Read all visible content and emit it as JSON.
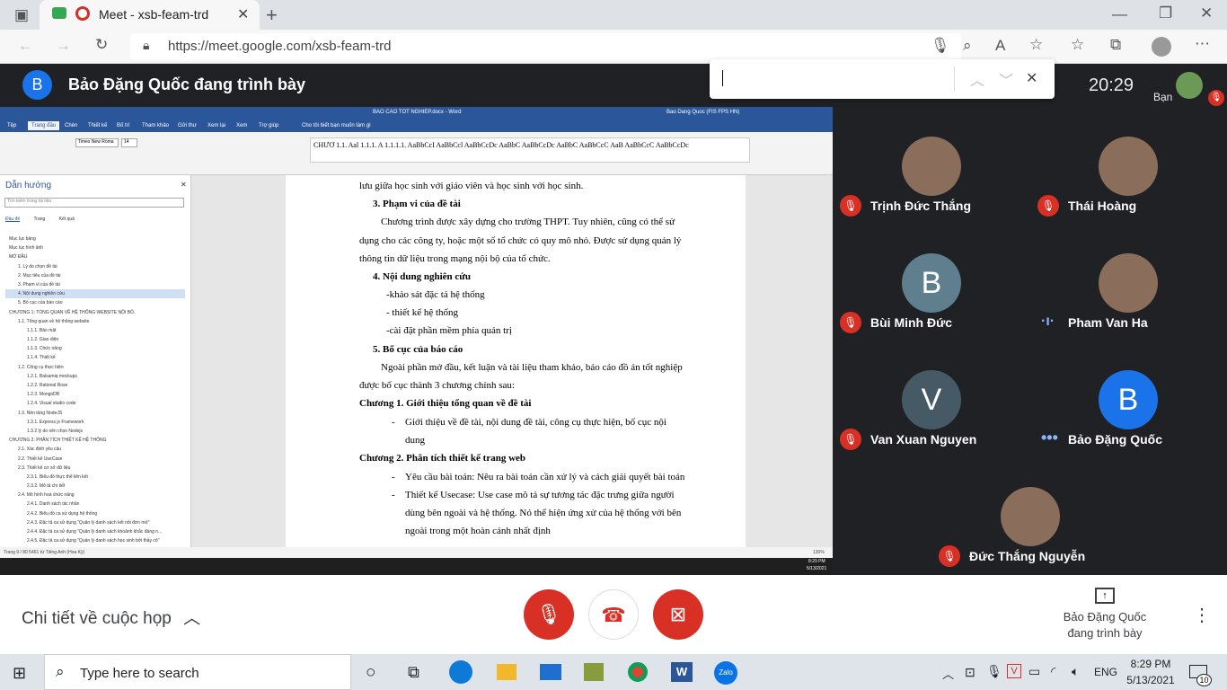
{
  "browser": {
    "tab_title": "Meet - xsb-feam-trd",
    "url": "https://meet.google.com/xsb-feam-trd"
  },
  "meet": {
    "presenter_banner": "Bảo Đặng Quốc đang trình bày",
    "avatar_letter": "B",
    "clock": "20:29",
    "self_label": "Bạn",
    "details_label": "Chi tiết về cuộc họp",
    "presenter_label": "Bảo Đặng Quốc đang trình bày"
  },
  "participants": [
    {
      "name": "Trịnh Đức Thắng",
      "avatar": "photo",
      "status": "muted"
    },
    {
      "name": "Thái Hoàng",
      "avatar": "photo",
      "status": "muted"
    },
    {
      "name": "Bùi Minh Đức",
      "avatar": "B",
      "status": "muted"
    },
    {
      "name": "Pham Van Ha",
      "avatar": "photo",
      "status": "speaking"
    },
    {
      "name": "Van Xuan Nguyen",
      "avatar": "V",
      "status": "muted"
    },
    {
      "name": "Bảo Đặng Quốc",
      "avatar": "B",
      "status": "active"
    },
    {
      "name": "Đức Thắng Nguyễn",
      "avatar": "photo",
      "status": "muted"
    }
  ],
  "word": {
    "window_title": "BAO CAO TOT NGHIEP.docx - Word",
    "user": "Bao Dang Quoc (FIS FPS HN)",
    "tabs": [
      "Tệp",
      "Trang đầu",
      "Chèn",
      "Thiết kế",
      "Bố trí",
      "Tham khảo",
      "Gửi thư",
      "Xem lại",
      "Xem",
      "Trợ giúp",
      "Cho tôi biết bạn muốn làm gì"
    ],
    "font": "Times New Roma",
    "font_size": "14",
    "styles": [
      "AaBbCcDc",
      "AaBbCcI",
      "AaBbCcl",
      "AaBbCcDc",
      "AaBbC",
      "AaBbCcDc",
      "AaBbC",
      "AaBbCcC",
      "AaB",
      "AaBbCcC",
      "AaBbCcDc"
    ],
    "nav_title": "Dẫn hướng",
    "nav_search": "Tìm kiếm trong tài liệu",
    "nav_tabs": [
      "Đầu đề",
      "Trang",
      "Kết quả"
    ],
    "nav_items": [
      "Mục lục bảng",
      "Mục lục hình ảnh",
      "MỞ ĐẦU",
      "1. Lý do chọn đề tài",
      "2. Mục tiêu của đề tài",
      "3. Phạm vi của đề tài",
      "4. Nội dung nghiên cứu",
      "5. Bố cục của báo cáo",
      "CHƯƠNG 1: TỔNG QUAN VỀ HỆ THỐNG WEBSITE NỘI BỘ.",
      "1.1. Tổng quan về hệ thống website",
      "1.1.1. Bảo mật",
      "1.1.2. Giao diện",
      "1.1.3. Chức năng",
      "1.1.4. Thiết kế",
      "1.2. Công cụ thực hiện",
      "1.2.1. Balsamiq mockups",
      "1.2.2. Rational Rose",
      "1.2.3. MongoDB",
      "1.2.4. Visual studio code",
      "1.3. Nền tảng NodeJS",
      "1.3.1. Express js Framework",
      "1.3.2 lý do nên chọn Nodejs",
      "CHƯƠNG 2: PHÂN TÍCH THIẾT KẾ HỆ THỐNG",
      "2.1. Xác định yêu cầu",
      "2.2. Thiết kế UseCase",
      "2.3. Thiết kế cơ sở dữ liệu",
      "2.3.1. Biểu đồ thực thể liên kết",
      "2.3.2. Mô tả chi tiết",
      "2.4. Mô hình hoá chức năng",
      "2.4.1. Danh sách tác nhân",
      "2.4.2. Biểu đồ ca sử dụng hệ thống",
      "2.4.3. Đặc tả ca sử dụng \"Quản lý danh sách kết nối đơn mở\"",
      "2.4.4. Đặc tả ca sử dụng \"Quản lý danh sách khoảnh khắc đáng n...",
      "2.4.5. Đặc tả ca sử dụng \"Quản lý danh sách học sinh bởi thầy cô\""
    ],
    "doc_lines": {
      "l0": "lưu giữa học sinh với giáo viên và học sinh với học sinh.",
      "h3": "3.  Phạm vi của đề tài",
      "p3a": "Chương trình được xây dựng cho trường THPT. Tuy nhiên, cũng có thể sử",
      "p3b": "dụng cho các công ty, hoặc một số tổ chức có quy mô nhỏ. Được sử dụng quản lý",
      "p3c": "thông tin dữ liệu trong mạng nội bộ của tổ chức.",
      "h4": "4.  Nội dung nghiên cứu",
      "b1": "-khảo sát đặc tả hệ thống",
      "b2": "- thiết kế hệ thống",
      "b3": "-cài đặt phần mềm phía quản trị",
      "h5": "5.  Bố cục của báo cáo",
      "p5a": "Ngoài phần mở đầu, kết luận và tài liệu tham khảo, báo cáo đồ án tốt nghiệp",
      "p5b": "được bố cục thành 3 chương chính sau:",
      "c1": "Chương 1.  Giới thiệu tổng quan về đề tài",
      "c1a": "Giới thiệu về đề tài, nội dung đề tài, công cụ thực hiện, bố cục nội",
      "c1b": "dung",
      "c2": "Chương 2.  Phân tích thiết kế trang web",
      "c2a": "Yêu cầu bài toán: Nêu ra bài toán cần xử lý và cách giải quyết bài toán",
      "c2b": "Thiết kế Usecase: Use case mô tả sự tương tác đặc trưng giữa người",
      "c2c": "dùng bên ngoài và hệ thống. Nó thể hiện ứng xử của hệ thống với bên",
      "c2d": "ngoài trong một hoàn cảnh nhất định"
    },
    "status_left": "Trang 9 / 80   5461 từ   Tiếng Anh (Hoa Kỳ)",
    "zoom": "130%",
    "inner_time": "8:29 PM",
    "inner_date": "5/13/2021"
  },
  "taskbar": {
    "search_placeholder": "Type here to search",
    "language": "ENG",
    "time": "8:29 PM",
    "date": "5/13/2021",
    "notifications": "10"
  }
}
